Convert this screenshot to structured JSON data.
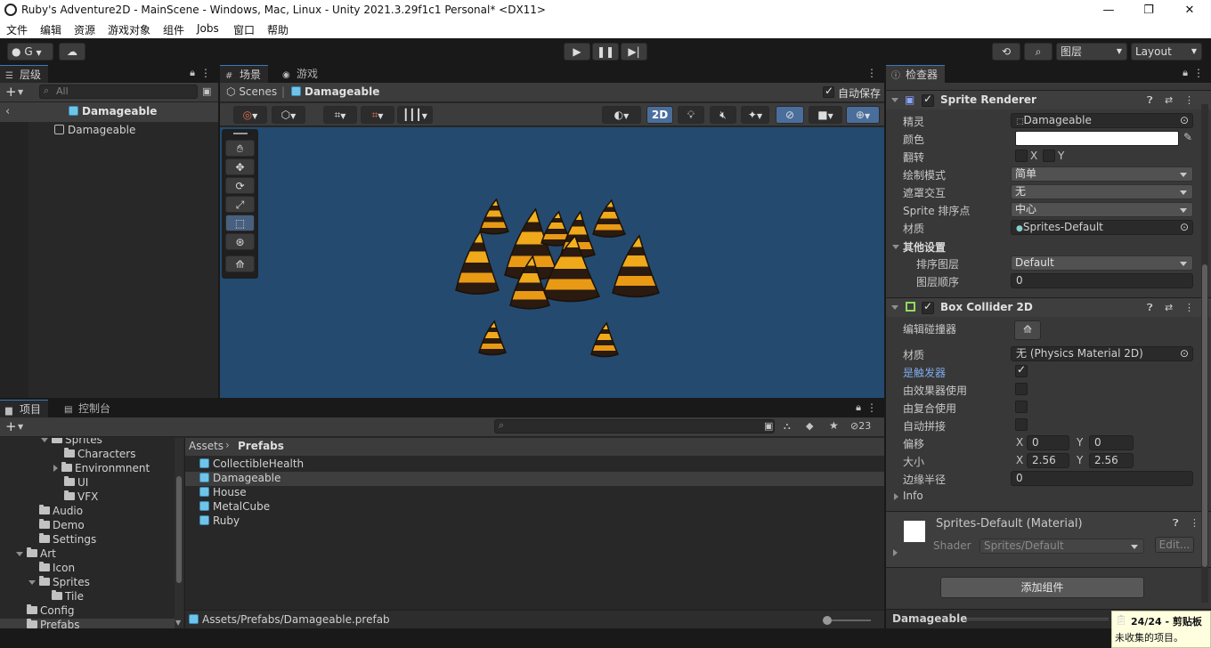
{
  "window": {
    "title": "Ruby's Adventure2D - MainScene - Windows, Mac, Linux - Unity 2021.3.29f1c1 Personal* <DX11>",
    "minimize": "—",
    "maximize": "❐",
    "close": "✕"
  },
  "menu": [
    "文件",
    "编辑",
    "资源",
    "游戏对象",
    "组件",
    "Jobs",
    "窗口",
    "帮助"
  ],
  "toolbar": {
    "account": "G",
    "layers_label": "图层",
    "layout_label": "Layout"
  },
  "hierarchy": {
    "tab": "层级",
    "search_placeholder": "All",
    "header": "Damageable",
    "items": [
      "Damageable"
    ]
  },
  "scene": {
    "tab_scene": "场景",
    "tab_game": "游戏",
    "breadcrumb_root": "Scenes",
    "breadcrumb_item": "Damageable",
    "autosave": "自动保存",
    "mode_2d": "2D"
  },
  "project": {
    "tab_project": "项目",
    "tab_console": "控制台",
    "hidden_count": "23",
    "tree": [
      {
        "label": "Sprites",
        "indent": 3,
        "kind": "open"
      },
      {
        "label": "Characters",
        "indent": 4,
        "kind": "leaf"
      },
      {
        "label": "Environmnent",
        "indent": 4,
        "kind": "closed"
      },
      {
        "label": "UI",
        "indent": 4,
        "kind": "leaf"
      },
      {
        "label": "VFX",
        "indent": 4,
        "kind": "leaf"
      },
      {
        "label": "Audio",
        "indent": 2,
        "kind": "leaf"
      },
      {
        "label": "Demo",
        "indent": 2,
        "kind": "leaf"
      },
      {
        "label": "Settings",
        "indent": 2,
        "kind": "leaf"
      },
      {
        "label": "Art",
        "indent": 1,
        "kind": "open"
      },
      {
        "label": "Icon",
        "indent": 2,
        "kind": "leaf"
      },
      {
        "label": "Sprites",
        "indent": 2,
        "kind": "open"
      },
      {
        "label": "Tile",
        "indent": 3,
        "kind": "leaf"
      },
      {
        "label": "Config",
        "indent": 1,
        "kind": "leaf"
      },
      {
        "label": "Prefabs",
        "indent": 1,
        "kind": "leaf"
      }
    ],
    "breadcrumb_root": "Assets",
    "breadcrumb_current": "Prefabs",
    "assets": [
      "CollectibleHealth",
      "Damageable",
      "House",
      "MetalCube",
      "Ruby"
    ],
    "selected_asset": "Damageable",
    "footer_path": "Assets/Prefabs/Damageable.prefab"
  },
  "inspector": {
    "tab": "检查器",
    "sprite_renderer": {
      "name": "Sprite Renderer",
      "sprite_label": "精灵",
      "sprite_value": "Damageable",
      "color_label": "颜色",
      "flip_label": "翻转",
      "flip_x": "X",
      "flip_y": "Y",
      "draw_mode_label": "绘制模式",
      "draw_mode_value": "简单",
      "mask_label": "遮罩交互",
      "mask_value": "无",
      "sort_point_label": "Sprite 排序点",
      "sort_point_value": "中心",
      "material_label": "材质",
      "material_value": "Sprites-Default",
      "other_label": "其他设置",
      "sorting_layer_label": "排序图层",
      "sorting_layer_value": "Default",
      "order_label": "图层顺序",
      "order_value": "0"
    },
    "box_collider": {
      "name": "Box Collider 2D",
      "edit_label": "编辑碰撞器",
      "material_label": "材质",
      "material_value": "无 (Physics Material 2D)",
      "trigger_label": "是触发器",
      "effector_label": "由效果器使用",
      "composite_label": "由复合使用",
      "autotiling_label": "自动拼接",
      "offset_label": "偏移",
      "offset_x": "0",
      "offset_y": "0",
      "size_label": "大小",
      "size_x": "2.56",
      "size_y": "2.56",
      "edge_label": "边缘半径",
      "edge_value": "0",
      "info_label": "Info",
      "x_label": "X",
      "y_label": "Y"
    },
    "material": {
      "name": "Sprites-Default (Material)",
      "shader_label": "Shader",
      "shader_value": "Sprites/Default",
      "edit_button": "Edit..."
    },
    "add_component": "添加组件",
    "footer_name": "Damageable"
  },
  "toast": {
    "title": "24/24 - 剪贴板",
    "message": "未收集的项目。"
  },
  "colors": {
    "accent": "#3a79bb",
    "scene_bg": "#244a6f",
    "selected_row": "#3e3e3e",
    "link_blue": "#7ea9e8"
  }
}
